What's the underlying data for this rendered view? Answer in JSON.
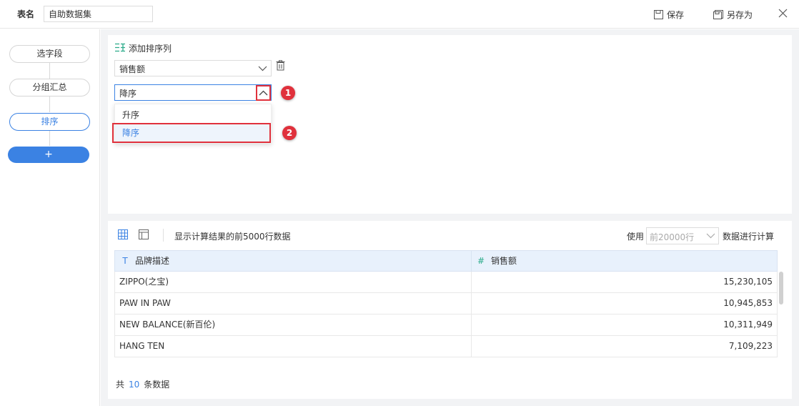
{
  "header": {
    "table_name_label": "表名",
    "table_name_value": "自助数据集",
    "save_label": "保存",
    "save_as_label": "另存为"
  },
  "steps": {
    "items": [
      {
        "label": "选字段"
      },
      {
        "label": "分组汇总"
      },
      {
        "label": "排序"
      }
    ],
    "add_label": "+"
  },
  "sort": {
    "add_sort_label": "添加排序列",
    "field_value": "销售额",
    "order_value": "降序",
    "options": [
      {
        "label": "升序"
      },
      {
        "label": "降序"
      }
    ],
    "callouts": [
      "1",
      "2"
    ]
  },
  "preview": {
    "note": "显示计算结果的前5000行数据",
    "use_label": "使用",
    "rows_option": "前20000行",
    "calc_label": "数据进行计算",
    "columns": [
      {
        "type_icon": "T",
        "label": "品牌描述"
      },
      {
        "type_icon": "#",
        "label": "销售额"
      }
    ],
    "rows": [
      {
        "brand": "ZIPPO(之宝)",
        "sales": "15,230,105"
      },
      {
        "brand": "PAW IN PAW",
        "sales": "10,945,853"
      },
      {
        "brand": "NEW BALANCE(新百伦)",
        "sales": "10,311,949"
      },
      {
        "brand": "HANG TEN",
        "sales": "7,109,223"
      }
    ],
    "total_prefix": "共",
    "total_count": "10",
    "total_suffix": "条数据"
  },
  "colors": {
    "accent": "#3b82e3",
    "highlight": "#e0313c"
  }
}
